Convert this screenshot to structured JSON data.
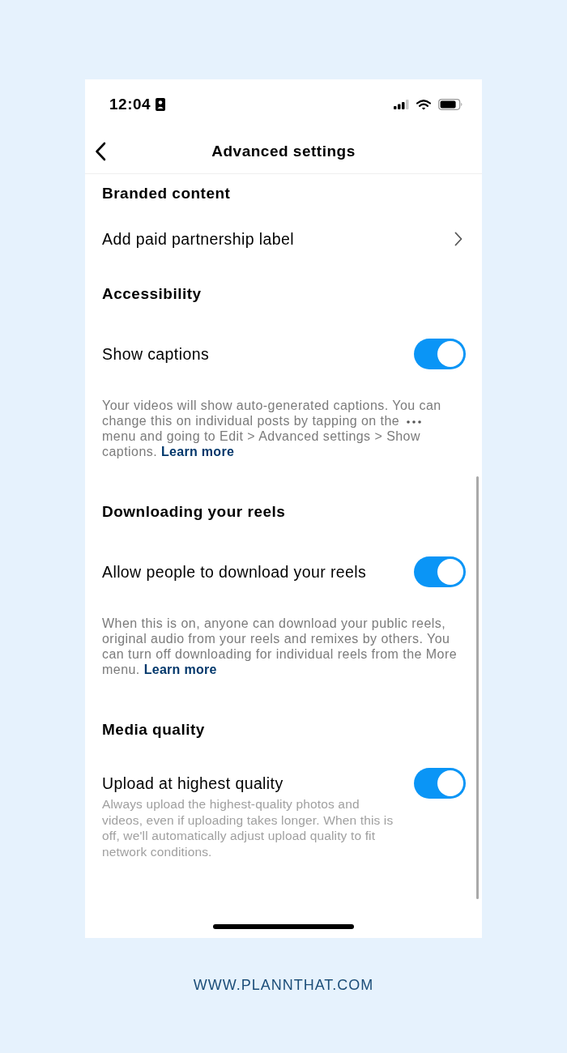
{
  "status_bar": {
    "time": "12:04"
  },
  "nav": {
    "title": "Advanced settings"
  },
  "sections": [
    {
      "title": "Branded content",
      "items": [
        {
          "kind": "link",
          "label": "Add paid partnership label"
        }
      ]
    },
    {
      "title": "Accessibility",
      "items": [
        {
          "kind": "toggle",
          "label": "Show captions",
          "on": true,
          "description": [
            {
              "kind": "text",
              "text": "Your videos will show auto-generated captions. You can change this on individual posts by tapping on the"
            },
            {
              "kind": "icon"
            },
            {
              "kind": "text",
              "text": "menu and going to Edit > Advanced settings > Show captions."
            },
            {
              "kind": "link",
              "text": "Learn more"
            }
          ]
        }
      ]
    },
    {
      "title": "Downloading your reels",
      "items": [
        {
          "kind": "toggle",
          "label": "Allow people to download your reels",
          "on": true,
          "description": [
            {
              "kind": "text",
              "text": "When this is on, anyone can download your public reels, original audio from your reels and remixes by others. You can turn off downloading for individual reels from the More menu."
            },
            {
              "kind": "link",
              "text": "Learn more"
            }
          ]
        }
      ]
    },
    {
      "title": "Media quality",
      "items": [
        {
          "kind": "toggle_detail",
          "label": "Upload at highest quality",
          "on": true,
          "description": [
            {
              "kind": "text",
              "text": "Always upload the highest-quality photos and videos, even if uploading takes longer. When this is off, we'll automatically adjust upload quality to fit network conditions."
            }
          ]
        }
      ]
    }
  ],
  "footer": "WWW.PLANNTHAT.COM"
}
